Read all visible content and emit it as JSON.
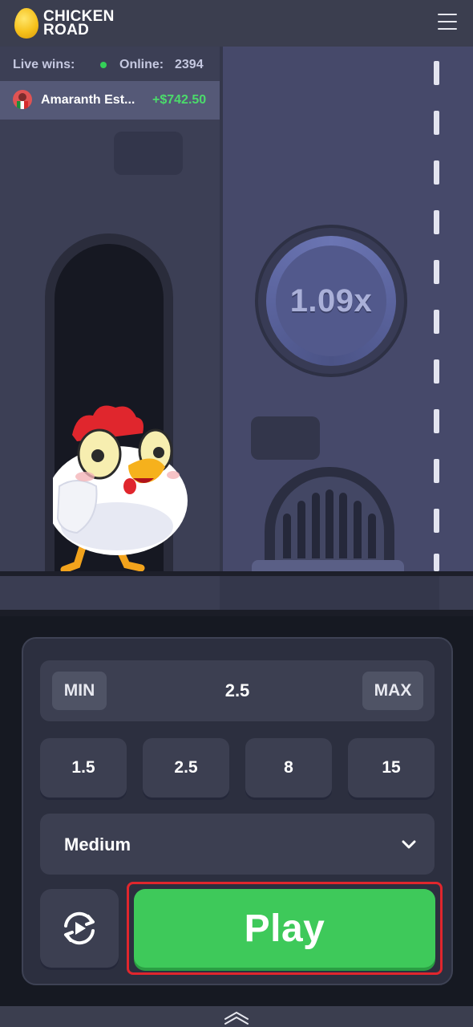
{
  "header": {
    "logo_line1": "CHICKEN",
    "logo_line2": "ROAD",
    "menu_icon": "hamburger-menu-icon"
  },
  "live": {
    "label": "Live wins:",
    "online_label": "Online:",
    "online_count": "2394",
    "latest_win": {
      "name": "Amaranth Est...",
      "amount": "+$742.50"
    }
  },
  "game": {
    "multiplier": "1.09x"
  },
  "controls": {
    "min_label": "MIN",
    "max_label": "MAX",
    "bet_value": "2.5",
    "quick_bets": [
      "1.5",
      "2.5",
      "8",
      "15"
    ],
    "difficulty": "Medium",
    "play_label": "Play",
    "auto_icon": "auto-play-icon"
  },
  "colors": {
    "play": "#3ec95a",
    "win_amount": "#4bdb6b",
    "highlight": "#e0262d",
    "panel": "#2c2f3f"
  }
}
